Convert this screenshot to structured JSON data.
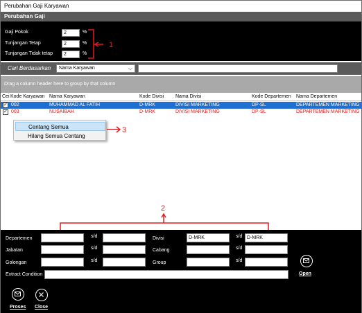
{
  "window": {
    "title": "Perubahan Gaji Karyawan"
  },
  "top_panel": {
    "header": "Perubahan Gaji",
    "fields": [
      {
        "label": "Gaji Pokok",
        "value": "2",
        "unit": "%"
      },
      {
        "label": "Tunjangan Tetap",
        "value": "2",
        "unit": "%"
      },
      {
        "label": "Tunjangan Tidak tetap",
        "value": "2",
        "unit": "%"
      }
    ]
  },
  "search": {
    "label": "Cari Berdasarkan",
    "selected": "Nama Karyawan",
    "value": ""
  },
  "group_hint": "Drag a column header here to group by that column",
  "grid": {
    "columns": [
      "Cei",
      "Kode Karyawan",
      "Nama Karyawan",
      "Kode Divisi",
      "Nama Divisi",
      "Kode Departemen",
      "Nama Departemen"
    ],
    "rows": [
      {
        "checked": true,
        "kode": "002",
        "nama": "MUHAMMAD AL FATIH",
        "kode_divisi": "D-MRK",
        "nama_divisi": "DIVISI MARKETING",
        "kode_dept": "DP-SL",
        "nama_dept": "DEPARTEMEN MARKETING",
        "selected": true
      },
      {
        "checked": true,
        "kode": "003",
        "nama": "NUSAIBAH",
        "kode_divisi": "D-MRK",
        "nama_divisi": "DIVISI MARKETING",
        "kode_dept": "DP-SL",
        "nama_dept": "DEPARTEMEN MARKETING",
        "selected": false
      }
    ]
  },
  "context_menu": {
    "items": [
      "Centang Semua",
      "Hilang Semua Centang"
    ]
  },
  "annotations": {
    "one": "1",
    "two": "2",
    "three": "3"
  },
  "filters": {
    "departemen_label": "Departemen",
    "jabatan_label": "Jabatan",
    "golongan_label": "Golongan",
    "divisi_label": "Divisi",
    "cabang_label": "Cabang",
    "group_label": "Group",
    "sd": "s/d",
    "divisi_from": "D-MRK",
    "divisi_to": "D-MRK",
    "extract_label": "Extract Condition",
    "open_label": "Open"
  },
  "actions": {
    "proses": "Proses",
    "close": "Close"
  },
  "colors": {
    "selection": "#1e6fd0",
    "annotation": "#e21b1b",
    "panel": "#000000",
    "header": "#5b5b5b"
  }
}
